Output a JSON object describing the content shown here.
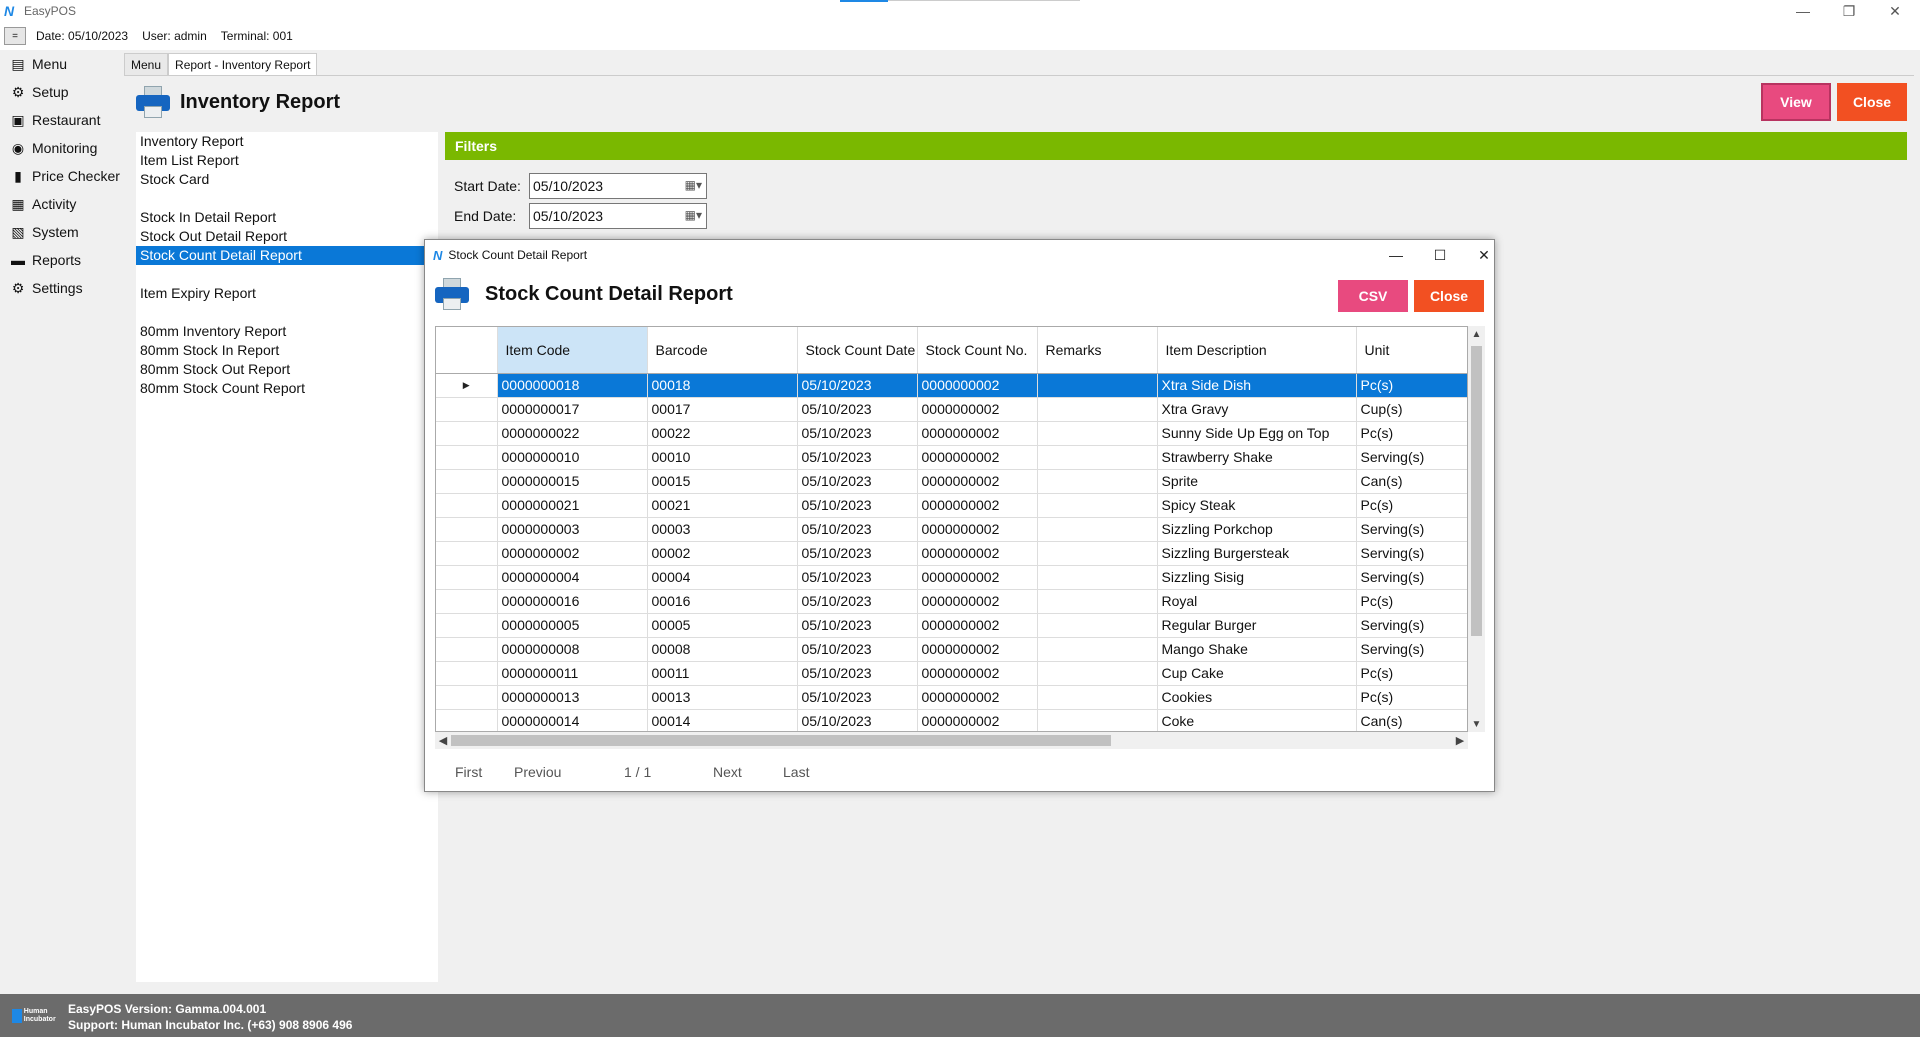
{
  "window": {
    "title": "EasyPOS",
    "logo_text": "N"
  },
  "infobar": {
    "toggle": "=",
    "date": "Date: 05/10/2023",
    "user": "User: admin",
    "terminal": "Terminal: 001"
  },
  "nav": {
    "items": [
      {
        "label": "Menu",
        "icon": "menu-icon",
        "glyph": "▤"
      },
      {
        "label": "Setup",
        "icon": "setup-icon",
        "glyph": "⚙"
      },
      {
        "label": "Restaurant",
        "icon": "restaurant-icon",
        "glyph": "▣"
      },
      {
        "label": "Monitoring",
        "icon": "monitoring-icon",
        "glyph": "◉"
      },
      {
        "label": "Price Checker",
        "icon": "price-checker-icon",
        "glyph": "▮"
      },
      {
        "label": "Activity",
        "icon": "activity-icon",
        "glyph": "▦"
      },
      {
        "label": "System",
        "icon": "system-icon",
        "glyph": "▧"
      },
      {
        "label": "Reports",
        "icon": "reports-icon",
        "glyph": "▬"
      },
      {
        "label": "Settings",
        "icon": "settings-icon",
        "glyph": "⚙"
      }
    ]
  },
  "tabs": [
    {
      "label": "Menu"
    },
    {
      "label": "Report - Inventory Report"
    }
  ],
  "main": {
    "title": "Inventory Report",
    "view_label": "View",
    "close_label": "Close",
    "filters_label": "Filters",
    "start_date_label": "Start Date:",
    "start_date_value": "05/10/2023",
    "end_date_label": "End Date:",
    "end_date_value": "05/10/2023",
    "report_list": [
      "Inventory Report",
      "Item List Report",
      "Stock Card",
      "",
      "Stock In Detail Report",
      "Stock Out Detail Report",
      "Stock Count Detail Report",
      "",
      "Item Expiry Report",
      "",
      "80mm Inventory Report",
      "80mm Stock In Report",
      "80mm Stock Out Report",
      "80mm Stock Count Report"
    ],
    "selected_report_index": 6
  },
  "dialog": {
    "window_title": "Stock Count Detail Report",
    "title": "Stock Count Detail Report",
    "csv_label": "CSV",
    "close_label": "Close",
    "columns": [
      "Item Code",
      "Barcode",
      "Stock Count Date",
      "Stock Count No.",
      "Remarks",
      "Item Description",
      "Unit"
    ],
    "rows": [
      [
        "0000000018",
        "00018",
        "05/10/2023",
        "0000000002",
        "",
        "Xtra Side Dish",
        "Pc(s)"
      ],
      [
        "0000000017",
        "00017",
        "05/10/2023",
        "0000000002",
        "",
        "Xtra Gravy",
        "Cup(s)"
      ],
      [
        "0000000022",
        "00022",
        "05/10/2023",
        "0000000002",
        "",
        "Sunny Side Up Egg on Top",
        "Pc(s)"
      ],
      [
        "0000000010",
        "00010",
        "05/10/2023",
        "0000000002",
        "",
        "Strawberry Shake",
        "Serving(s)"
      ],
      [
        "0000000015",
        "00015",
        "05/10/2023",
        "0000000002",
        "",
        "Sprite",
        "Can(s)"
      ],
      [
        "0000000021",
        "00021",
        "05/10/2023",
        "0000000002",
        "",
        "Spicy Steak",
        "Pc(s)"
      ],
      [
        "0000000003",
        "00003",
        "05/10/2023",
        "0000000002",
        "",
        "Sizzling Porkchop",
        "Serving(s)"
      ],
      [
        "0000000002",
        "00002",
        "05/10/2023",
        "0000000002",
        "",
        "Sizzling Burgersteak",
        "Serving(s)"
      ],
      [
        "0000000004",
        "00004",
        "05/10/2023",
        "0000000002",
        "",
        "Sizzling  Sisig",
        "Serving(s)"
      ],
      [
        "0000000016",
        "00016",
        "05/10/2023",
        "0000000002",
        "",
        "Royal",
        "Pc(s)"
      ],
      [
        "0000000005",
        "00005",
        "05/10/2023",
        "0000000002",
        "",
        "Regular Burger",
        "Serving(s)"
      ],
      [
        "0000000008",
        "00008",
        "05/10/2023",
        "0000000002",
        "",
        "Mango Shake",
        "Serving(s)"
      ],
      [
        "0000000011",
        "00011",
        "05/10/2023",
        "0000000002",
        "",
        "Cup Cake",
        "Pc(s)"
      ],
      [
        "0000000013",
        "00013",
        "05/10/2023",
        "0000000002",
        "",
        "Cookies",
        "Pc(s)"
      ],
      [
        "0000000014",
        "00014",
        "05/10/2023",
        "0000000002",
        "",
        "Coke",
        "Can(s)"
      ]
    ],
    "selected_row_index": 0,
    "pager": {
      "first": "First",
      "previous": "Previou",
      "page": "1 / 1",
      "next": "Next",
      "last": "Last"
    }
  },
  "status": {
    "logo_text": "Human Incubator",
    "version": "EasyPOS Version: Gamma.004.001",
    "support": "Support: Human Incubator Inc. (+63) 908 8906 496"
  },
  "colors": {
    "accent_blue": "#0a78d7",
    "view_pink": "#e84a7f",
    "close_orange": "#f25022",
    "filters_green": "#7ab800",
    "status_gray": "#6b6b6b"
  }
}
